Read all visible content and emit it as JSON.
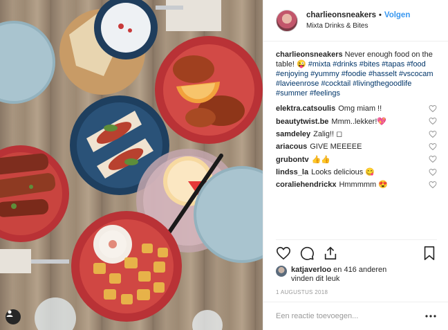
{
  "header": {
    "username": "charlieonsneakers",
    "separator": "•",
    "follow_label": "Volgen",
    "location": "Mixta Drinks & Bites"
  },
  "caption": {
    "username": "charlieonsneakers",
    "text": "Never enough food on the table!",
    "emoji": "😜",
    "hashtags": [
      "#mixta",
      "#drinks",
      "#bites",
      "#tapas",
      "#food",
      "#enjoying",
      "#yummy",
      "#foodie",
      "#hasselt",
      "#vscocam",
      "#lavieenrose",
      "#cocktail",
      "#livingthegoodlife",
      "#summer",
      "#feelings"
    ]
  },
  "comments": [
    {
      "username": "elektra.catsoulis",
      "text": "Omg miam !!"
    },
    {
      "username": "beautytwist.be",
      "text": "Mmm..lekker!💖"
    },
    {
      "username": "samdeley",
      "text": "Zalig!! ◻"
    },
    {
      "username": "ariacous",
      "text": "GIVE MEEEEE"
    },
    {
      "username": "grubontv",
      "text": "👍👍"
    },
    {
      "username": "lindss_la",
      "text": "Looks delicious 😋"
    },
    {
      "username": "coraliehendrickx",
      "text": "Hmmmmm 😍"
    }
  ],
  "likes": {
    "username": "katjaverloo",
    "text": "en 416 anderen",
    "text2": "vinden dit leuk"
  },
  "date": "1 AUGUSTUS 2018",
  "add_comment": {
    "placeholder": "Een reactie toevoegen..."
  },
  "icons": {
    "like": "heart-icon",
    "comment": "comment-icon",
    "share": "share-icon",
    "save": "bookmark-icon",
    "more": "more-options-icon",
    "tagged_user": "user-tag-icon"
  },
  "colors": {
    "accent": "#3897f0",
    "hashtag": "#003569",
    "text": "#262626",
    "muted": "#999999",
    "border": "#efefef"
  }
}
